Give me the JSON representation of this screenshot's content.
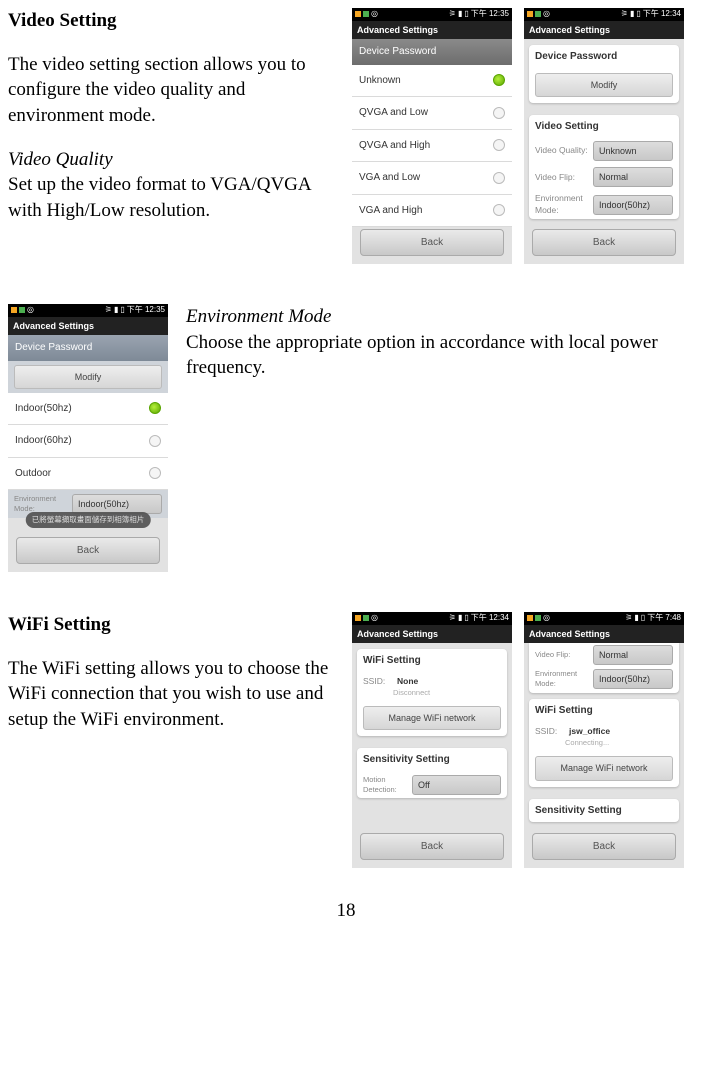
{
  "page_number": "18",
  "s1": {
    "title": "Video Setting",
    "intro": "The video setting section allows you to configure the video quality and environment mode.",
    "sub1_title": "Video Quality",
    "sub1_body": "Set up the video format to VGA/QVGA with High/Low resolution."
  },
  "s2": {
    "sub_title": "Environment Mode",
    "body": "Choose the appropriate option in accordance with local power frequency."
  },
  "s3": {
    "title": "WiFi Setting",
    "body": "The WiFi setting allows you to choose the WiFi connection that you wish to use and setup the WiFi environment."
  },
  "screenshots": {
    "a": {
      "time": "下午 12:35",
      "header": "Advanced Settings",
      "selector": "Device Password",
      "options": [
        "Unknown",
        "QVGA and Low",
        "QVGA and High",
        "VGA and Low",
        "VGA and High"
      ],
      "selected": 0,
      "back": "Back"
    },
    "b": {
      "time": "下午 12:34",
      "header": "Advanced Settings",
      "card1_title": "Device Password",
      "card1_btn": "Modify",
      "card2_title": "Video Setting",
      "kv": [
        {
          "label": "Video Quality:",
          "value": "Unknown"
        },
        {
          "label": "Video Flip:",
          "value": "Normal"
        },
        {
          "label": "Environment Mode:",
          "value": "Indoor(50hz)"
        }
      ],
      "back": "Back"
    },
    "c": {
      "time": "下午 12:35",
      "header": "Advanced Settings",
      "top_label": "Device Password",
      "top_btn": "Modify",
      "options": [
        "Indoor(50hz)",
        "Indoor(60hz)",
        "Outdoor"
      ],
      "selected": 0,
      "kv_label": "Environment Mode:",
      "kv_value": "Indoor(50hz)",
      "toast": "已將螢幕擷取畫面儲存到相簿相片",
      "back": "Back"
    },
    "d": {
      "time": "下午 12:34",
      "header": "Advanced Settings",
      "card1_title": "WiFi Setting",
      "ssid_label": "SSID:",
      "ssid_value": "None",
      "ssid_sub": "Disconnect",
      "manage_btn": "Manage WiFi network",
      "card2_title": "Sensitivity Setting",
      "md_label": "Motion Detection:",
      "md_value": "Off",
      "back": "Back"
    },
    "e": {
      "time": "下午 7:48",
      "header": "Advanced Settings",
      "vf_label": "Video Flip:",
      "vf_value": "Normal",
      "env_label": "Environment Mode:",
      "env_value": "Indoor(50hz)",
      "card1_title": "WiFi Setting",
      "ssid_label": "SSID:",
      "ssid_value": "jsw_office",
      "ssid_sub": "Connecting...",
      "manage_btn": "Manage WiFi network",
      "card2_title": "Sensitivity Setting",
      "back": "Back"
    }
  }
}
